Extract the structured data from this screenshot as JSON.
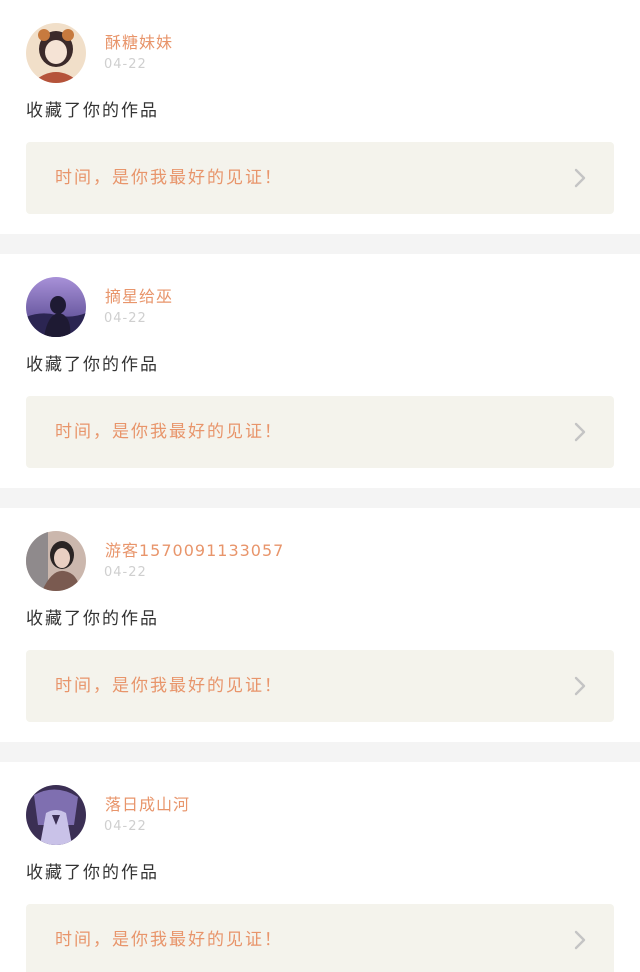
{
  "feed": {
    "items": [
      {
        "username": "酥糖妹妹",
        "date": "04-22",
        "action": "收藏了你的作品",
        "card_text": "时间，是你我最好的见证！",
        "avatar_icon": "avatar-girl-costume",
        "avatar_colors": [
          "#f1dfc9",
          "#b5533a",
          "#3b2a2a"
        ]
      },
      {
        "username": "摘星给巫",
        "date": "04-22",
        "action": "收藏了你的作品",
        "card_text": "时间，是你我最好的见证！",
        "avatar_icon": "avatar-silhouette-purple",
        "avatar_colors": [
          "#6c5fb0",
          "#a891d8",
          "#1e1a33"
        ]
      },
      {
        "username": "游客1570091133057",
        "date": "04-22",
        "action": "收藏了你的作品",
        "card_text": "时间，是你我最好的见证！",
        "avatar_icon": "avatar-girl-window",
        "avatar_colors": [
          "#cbb7ad",
          "#7a5a50",
          "#2a2424"
        ]
      },
      {
        "username": "落日成山河",
        "date": "04-22",
        "action": "收藏了你的作品",
        "card_text": "时间，是你我最好的见证！",
        "avatar_icon": "avatar-girl-uniform",
        "avatar_colors": [
          "#3b2f54",
          "#c9c2e8",
          "#7f6fb0"
        ]
      }
    ],
    "accent_color": "#e8956b",
    "chevron_icon": "chevron-right-icon"
  }
}
